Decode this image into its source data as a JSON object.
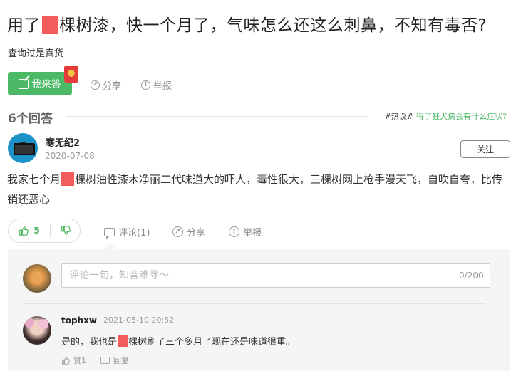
{
  "question": {
    "title_before": "用了",
    "title_after": "棵树漆，快一个月了，气味怎么还这么刺鼻，不知有毒否?",
    "description": "查询过是真货"
  },
  "actions": {
    "answer_label": "我来答",
    "share_label": "分享",
    "report_label": "举报"
  },
  "answers_header": {
    "count_label": "6个回答",
    "hot_tag": "#热议#",
    "hot_link": "得了狂犬病会有什么症状?"
  },
  "answer": {
    "user": "寒无纪2",
    "date": "2020-07-08",
    "follow_label": "关注",
    "text_before": "我家七个月",
    "text_after": "棵树油性漆木净丽二代味道大的吓人，毒性很大，三棵树网上枪手漫天飞，自吹自夸，比传销还恶心",
    "upvotes": "5",
    "comment_label": "评论(1)",
    "share_label": "分享",
    "report_label": "举报"
  },
  "comment_box": {
    "placeholder": "评论一句，知音难寻～",
    "char_count": "0/200"
  },
  "comment": {
    "user": "tophxw",
    "date": "2021-05-10 20:52",
    "text_before": "是的，我也是",
    "text_after": "棵树刷了三个多月了现在还是味道很重。",
    "like_label": "赞1",
    "reply_label": "回复"
  },
  "colors": {
    "accent_green": "#4bb965",
    "redaction": "#f25c5c",
    "panel_bg": "#f5f5f5"
  },
  "icons": [
    "edit-icon",
    "red-envelope-icon",
    "share-icon",
    "report-icon",
    "thumbs-up-icon",
    "thumbs-down-icon",
    "comment-icon"
  ]
}
